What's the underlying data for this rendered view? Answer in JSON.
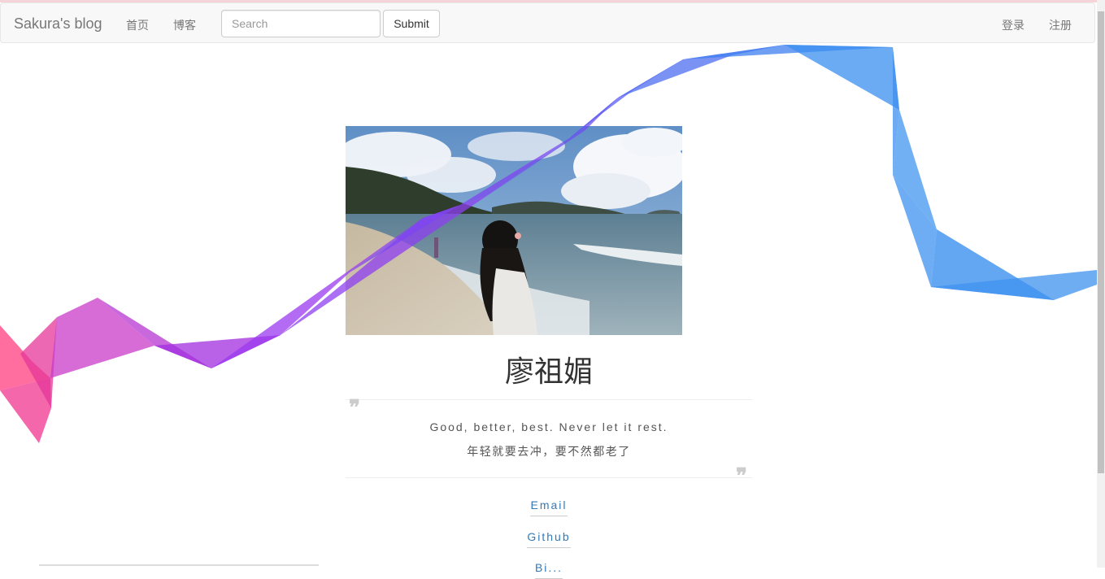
{
  "navbar": {
    "brand": "Sakura's blog",
    "links": [
      "首页",
      "博客"
    ],
    "search_placeholder": "Search",
    "submit_label": "Submit",
    "right_links": [
      "登录",
      "注册"
    ]
  },
  "profile": {
    "name": "廖祖媚",
    "quote_en": "Good, better, best. Never let it rest.",
    "quote_cn": "年轻就要去冲，要不然都老了",
    "links": [
      "Email",
      "Github",
      "Bi..."
    ]
  },
  "colors": {
    "link": "#337ab7",
    "navbar_bg": "#f8f8f8",
    "ribbon_pink": "#ff3d7f",
    "ribbon_purple": "#9b30ff",
    "ribbon_blue": "#3a8ff0"
  }
}
